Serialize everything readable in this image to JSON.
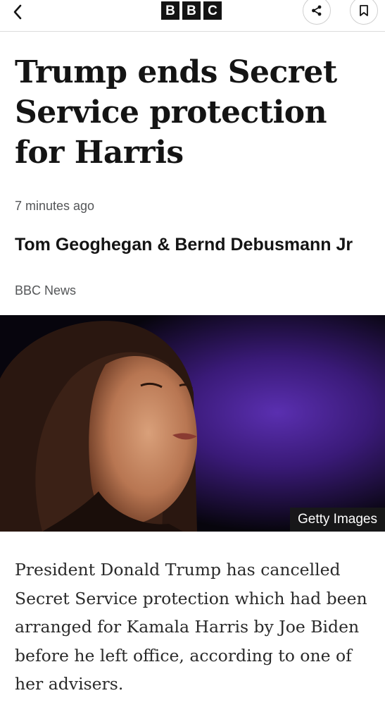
{
  "header": {
    "logo_letters": [
      "B",
      "B",
      "C"
    ],
    "back_icon": "chevron-left-icon",
    "share_icon": "share-icon",
    "bookmark_icon": "bookmark-icon"
  },
  "article": {
    "headline": "Trump ends Secret Service protection for Harris",
    "timestamp": "7 minutes ago",
    "authors": "Tom Geoghegan &  Bernd Debusmann Jr",
    "outlet": "BBC News",
    "image_credit": "Getty Images",
    "body": "President Donald Trump has cancelled Secret Service protection which had been arranged for Kamala Harris by Joe Biden before he left office, according to one of her advisers."
  },
  "colors": {
    "text_primary": "#141414",
    "text_secondary": "#545658",
    "divider": "#dcdcdc",
    "image_background": "#3a1a78"
  }
}
